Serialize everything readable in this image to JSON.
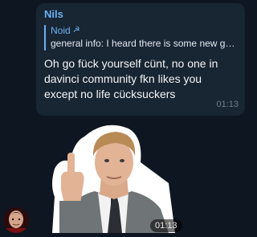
{
  "message": {
    "sender": "Nils",
    "reply": {
      "author": "Noid",
      "author_icon": "hammer-sickle-icon",
      "text": "general info: I heard there is some new guy..."
    },
    "text": "Oh go fück yourself cünt, no one in davinci community fkn likes you except no life cücksuckers",
    "time": "01:13"
  },
  "sticker": {
    "icon": "middle-finger-sticker",
    "time": "01:13"
  },
  "colors": {
    "background": "#0e1621",
    "bubble": "#182533",
    "accent": "#6ab2f2",
    "time": "#6d7f8f"
  }
}
